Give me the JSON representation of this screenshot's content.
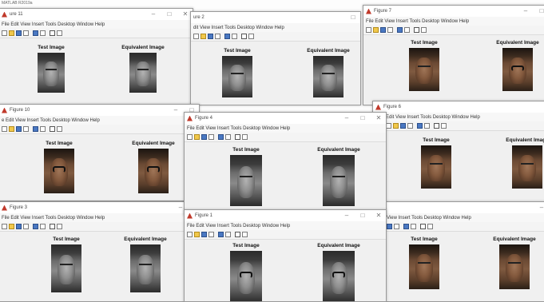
{
  "top_strip": {
    "label": "MATLAB R2019a"
  },
  "menu_items": [
    "File",
    "Edit",
    "View",
    "Insert",
    "Tools",
    "Desktop",
    "Window",
    "Help"
  ],
  "menu_items_alt": [
    "Edit",
    "View",
    "Insert",
    "Tools",
    "Desktop",
    "Window",
    "Help"
  ],
  "menu_items_w5": [
    "View",
    "Insert",
    "Tools",
    "Desktop",
    "Window",
    "Help"
  ],
  "panel_labels": {
    "test": "Test Image",
    "equivalent": "Equivalent Image"
  },
  "windows": [
    {
      "id": "w11",
      "title": "ure 11",
      "menu": "File Edit View Insert Tools Desktop Window Help"
    },
    {
      "id": "w2",
      "title": "ure 2",
      "menu": "dit View Insert Tools Desktop Window Help"
    },
    {
      "id": "w7",
      "title": "Figure 7",
      "menu": "File Edit View Insert Tools Desktop Window Help"
    },
    {
      "id": "w10",
      "title": "Figure 10",
      "menu": "e Edit View Insert Tools Desktop Window Help"
    },
    {
      "id": "w4",
      "title": "Figure 4",
      "menu": "File Edit View Insert Tools Desktop Window Help"
    },
    {
      "id": "w6",
      "title": "Figure 6",
      "menu": "Edit View Insert Tools Desktop Window Help"
    },
    {
      "id": "w3",
      "title": "Figure 3",
      "menu": "File Edit View Insert Tools Desktop Window Help"
    },
    {
      "id": "w1",
      "title": "Figure 1",
      "menu": "File Edit View Insert Tools Desktop Window Help"
    },
    {
      "id": "w5",
      "title": "",
      "menu": "View Insert Tools Desktop Window Help"
    }
  ],
  "window_controls": {
    "minimize": "–",
    "maximize": "□",
    "close": "✕"
  },
  "colors": {
    "titlebar_bg": "#ffffff",
    "figure_bg": "#f0f0f0",
    "menubar_bg": "#f7f7f7"
  }
}
